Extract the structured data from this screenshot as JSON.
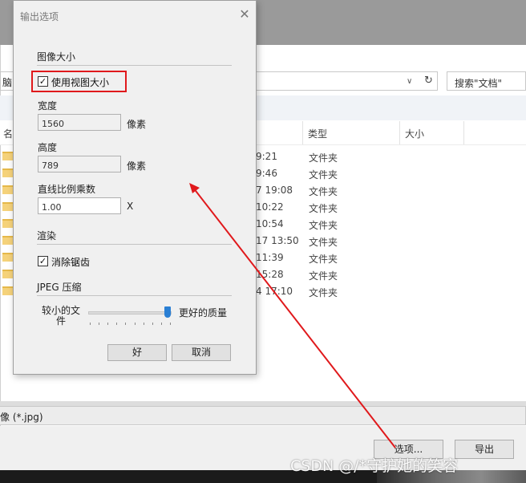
{
  "bg_dialog": {
    "address_text": "脑",
    "search_placeholder": "搜索\"文档\"",
    "refresh_icon": "refresh-icon",
    "columns": {
      "name": "名",
      "type": "类型",
      "size": "大小"
    },
    "rows": [
      {
        "date": "9:21",
        "type": "文件夹"
      },
      {
        "date": "9:46",
        "type": "文件夹"
      },
      {
        "date": "7 19:08",
        "type": "文件夹"
      },
      {
        "date": "10:22",
        "type": "文件夹"
      },
      {
        "date": "10:54",
        "type": "文件夹"
      },
      {
        "date": "17 13:50",
        "type": "文件夹"
      },
      {
        "date": "11:39",
        "type": "文件夹"
      },
      {
        "date": "15:28",
        "type": "文件夹"
      },
      {
        "date": "4 17:10",
        "type": "文件夹"
      }
    ],
    "filetype": "像 (*.jpg)",
    "options_button": "选项...",
    "export_button": "导出"
  },
  "options_dialog": {
    "title": "输出选项",
    "close_icon": "close-icon",
    "section_image_size": "图像大小",
    "use_view_size_label": "使用视图大小",
    "use_view_size_checked": true,
    "width_label": "宽度",
    "width_value": "1560",
    "width_unit": "像素",
    "height_label": "高度",
    "height_value": "789",
    "height_unit": "像素",
    "multiplier_label": "直线比例乘数",
    "multiplier_value": "1.00",
    "multiplier_unit": "X",
    "section_render": "渲染",
    "antialias_label": "消除锯齿",
    "antialias_checked": true,
    "section_jpeg": "JPEG 压缩",
    "slider_min_label": "较小的文件",
    "slider_max_label": "更好的质量",
    "quality_fraction": 0.95,
    "ok_button": "好",
    "cancel_button": "取消"
  },
  "annotation": {
    "highlight_color": "#e0191c",
    "arrow_color": "#e0191c"
  },
  "watermark": "CSDN @/*守护她的笑容"
}
